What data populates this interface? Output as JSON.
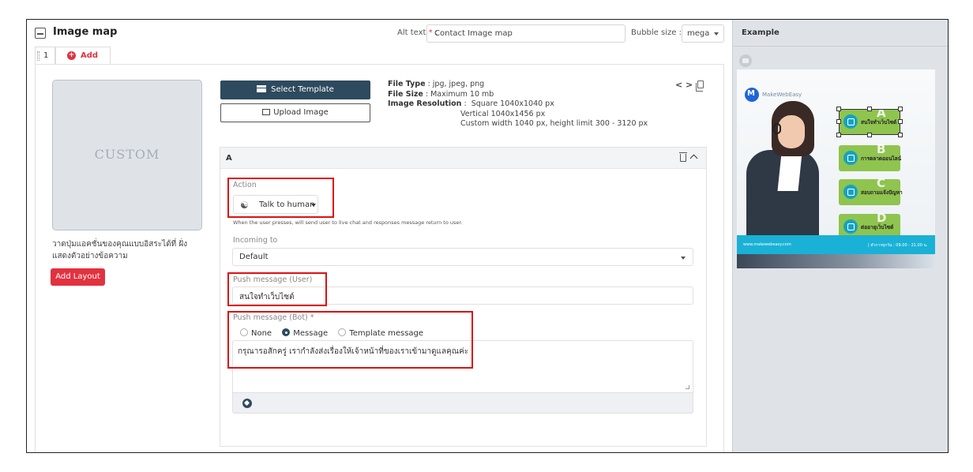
{
  "header": {
    "title": "Image map",
    "alt_text_label": "Alt text",
    "alt_text_required_mark": "*",
    "alt_text_colon": ":",
    "alt_text_value": "Contact Image map",
    "bubble_size_label": "Bubble size :",
    "bubble_size_value": "mega"
  },
  "tabs": {
    "first_number": "1",
    "add_label": "Add"
  },
  "left": {
    "custom_placeholder": "CUSTOM",
    "hint": "วาดปุ่มแอคชั่นของคุณแบบอิสระได้ที่ ฝั่งแสดงตัวอย่างข้อความ",
    "add_layout_label": "Add Layout"
  },
  "buttons": {
    "select_template": "Select Template",
    "upload_image": "Upload Image"
  },
  "file_info": {
    "type_label": "File Type",
    "type_value": "jpg, jpeg, png",
    "size_label": "File Size",
    "size_value": "Maximum 10 mb",
    "resolution_label": "Image Resolution",
    "res_square": "Square 1040x1040 px",
    "res_vertical": "Vertical 1040x1456 px",
    "res_custom": "Custom width 1040 px, height limit 300 - 3120 px"
  },
  "card": {
    "letter": "A",
    "action_label": "Action",
    "action_value": "Talk to human",
    "action_note": "When the user presses, will send user to live chat and responses message return to user.",
    "incoming_label": "Incoming to",
    "incoming_value": "Default",
    "push_user_label": "Push message (User)",
    "push_user_value": "สนใจทำเว็บไซต์",
    "push_bot_label": "Push message (Bot) *",
    "radio_none": "None",
    "radio_message": "Message",
    "radio_template": "Template message",
    "bot_message": "กรุณารอสักครู่ เรากำลังส่งเรื่องให้เจ้าหน้าที่ของเราเข้ามาดูแลคุณค่ะ"
  },
  "example": {
    "title": "Example",
    "brand": "MakeWebEasy",
    "buttons": [
      {
        "letter": "A",
        "text": "สนใจทำเว็บไซต์"
      },
      {
        "letter": "B",
        "text": "การตลาดออนไลน์"
      },
      {
        "letter": "C",
        "text": "สอบถามแจ้งปัญหา"
      },
      {
        "letter": "D",
        "text": "ต่ออายุเว็บไซต์"
      }
    ],
    "footer_left": "www.makewebeasy.com",
    "footer_right": "| ทำการทุกวัน : 09.00 - 21.00 น."
  },
  "colors": {
    "accent_red": "#e2323f",
    "dark_button": "#2e4a5e",
    "highlight_box": "#dd1111",
    "preview_button": "#8fc44f",
    "preview_band": "#1ab1d6"
  }
}
